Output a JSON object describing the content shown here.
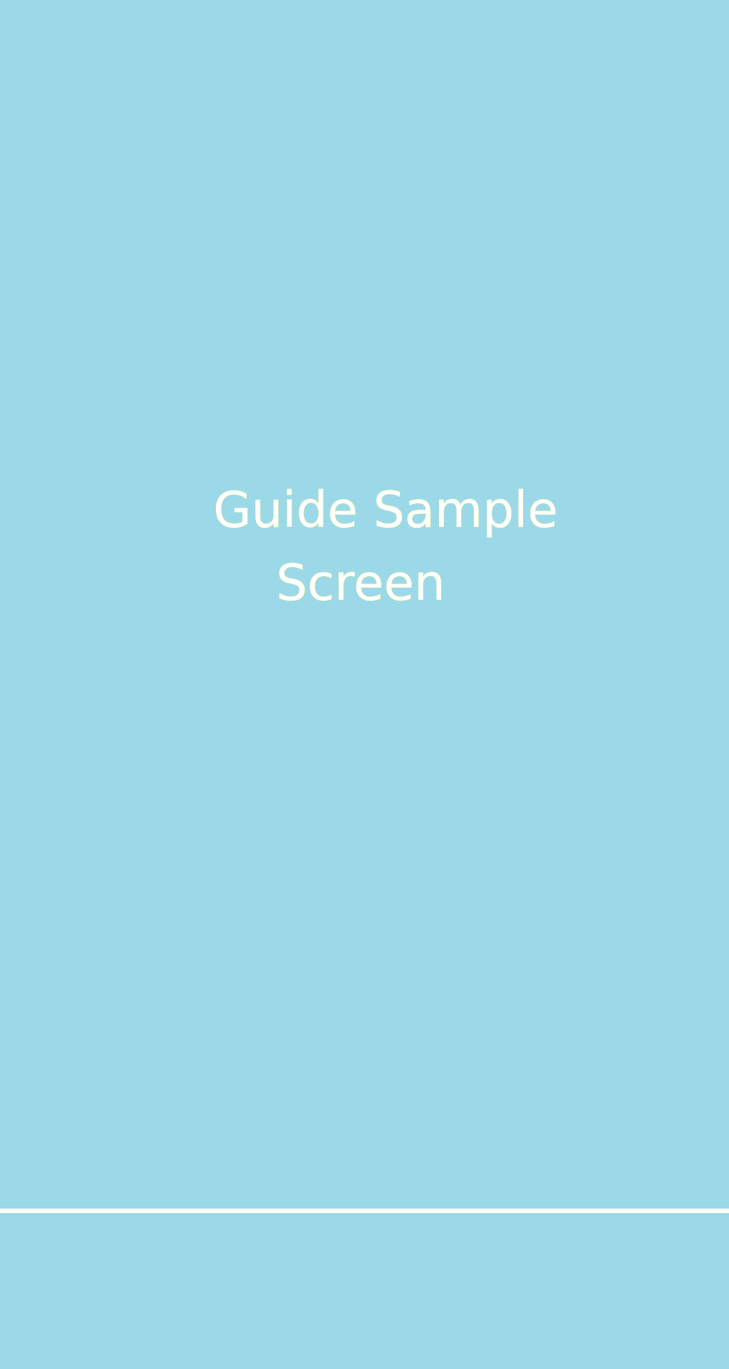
{
  "screen": {
    "title_lines": [
      "Guide Sample",
      "Screen"
    ]
  },
  "colors": {
    "background": "#9bd9e9",
    "title_text": "#ffffff",
    "title_outline": "#f2f27a",
    "divider": "#ffffff"
  }
}
